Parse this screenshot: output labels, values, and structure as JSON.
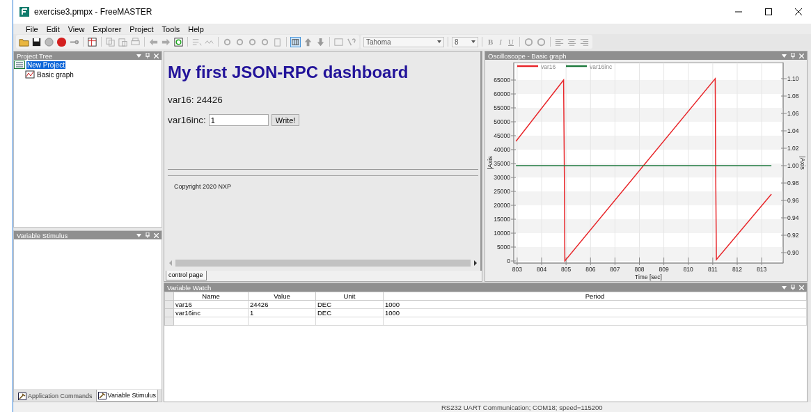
{
  "window": {
    "title": "exercise3.pmpx - FreeMASTER"
  },
  "menu": [
    "File",
    "Edit",
    "View",
    "Explorer",
    "Project",
    "Tools",
    "Help"
  ],
  "toolbar": {
    "font": "Tahoma",
    "font_size": "8",
    "format_buttons": [
      "B",
      "I",
      "U"
    ]
  },
  "project_tree": {
    "title": "Project Tree",
    "items": [
      {
        "label": "New Project",
        "selected": true,
        "children": [
          {
            "label": "Basic graph",
            "selected": false
          }
        ]
      }
    ]
  },
  "variable_stimulus": {
    "title": "Variable Stimulus"
  },
  "left_tabs": [
    {
      "label": "Application Commands",
      "selected": false
    },
    {
      "label": "Variable Stimulus",
      "selected": true
    }
  ],
  "control_page": {
    "heading": "My first JSON-RPC dashboard",
    "reading": "var16: 24426",
    "field_label": "var16inc:",
    "field_value": "1",
    "button": "Write!",
    "footer": "Copyright 2020 NXP",
    "tabs": [
      {
        "label": "control page",
        "selected": true
      }
    ]
  },
  "oscilloscope": {
    "title": "Oscilloscope - Basic graph",
    "chart_data": {
      "type": "line",
      "grid": true,
      "legend": "top",
      "xlabel": "Time [sec]",
      "ylabel": "|Axis",
      "y2label": "|Axis",
      "xlim": [
        802.86,
        813.88
      ],
      "ylim": [
        -750,
        71250
      ],
      "y2lim": [
        0.888,
        1.1184
      ],
      "xticks": [
        803,
        804,
        805,
        806,
        807,
        808,
        809,
        810,
        811,
        812,
        813
      ],
      "yticks": [
        0,
        5000,
        10000,
        15000,
        20000,
        25000,
        30000,
        35000,
        40000,
        45000,
        50000,
        55000,
        60000,
        65000
      ],
      "y2ticks": [
        {
          "value": 0.9,
          "label": "0.90"
        },
        {
          "value": 0.92,
          "label": "0.92"
        },
        {
          "value": 0.94,
          "label": "0.94"
        },
        {
          "value": 0.96,
          "label": "0.96"
        },
        {
          "value": 0.98,
          "label": "0.98"
        },
        {
          "value": 1,
          "label": "1.00"
        },
        {
          "value": 1.02,
          "label": "1.02"
        },
        {
          "value": 1.04,
          "label": "1.04"
        },
        {
          "value": 1.06,
          "label": "1.06"
        },
        {
          "value": 1.08,
          "label": "1.08"
        },
        {
          "value": 1.1,
          "label": "1.10"
        }
      ],
      "x": [
        802.95,
        804.9,
        804.93,
        804.95,
        811.1,
        811.12,
        811.15,
        813.4
      ],
      "series": [
        {
          "name": "var16",
          "color": "#e8262a",
          "axis": "y",
          "values": [
            43000,
            65000,
            32000,
            0,
            65500,
            32000,
            500,
            24000
          ]
        },
        {
          "name": "var16inc",
          "color": "#1f7a3e",
          "axis": "y2",
          "values": [
            1,
            1,
            1,
            1,
            1,
            1,
            1,
            1
          ]
        }
      ]
    }
  },
  "variable_watch": {
    "title": "Variable Watch",
    "columns": [
      "Name",
      "Value",
      "Unit",
      "Period"
    ],
    "rows": [
      [
        "var16",
        "24426",
        "DEC",
        "1000"
      ],
      [
        "var16inc",
        "1",
        "DEC",
        "1000"
      ]
    ]
  },
  "status_bar": "RS232 UART Communication; COM18; speed=115200"
}
